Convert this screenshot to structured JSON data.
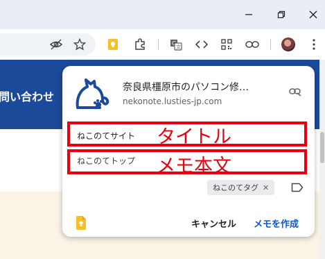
{
  "popup": {
    "site_title": "奈良県橿原市のパソコン修…",
    "site_url": "nekonote.lusties-jp.com",
    "title_field_value": "ねこのてサイト",
    "body_field_value": "ねこのてトップ",
    "annotation_title": "タイトル",
    "annotation_body": "メモ本文",
    "tag_label": "ねこのてタグ",
    "cancel_label": "キャンセル",
    "create_label": "メモを作成"
  },
  "page": {
    "nav_text": "問い合わせ"
  },
  "colors": {
    "accent_blue": "#0b57d0",
    "annotation_red": "#e8000f",
    "site_header": "#1c4a9a",
    "keep_yellow": "#f6bf26"
  }
}
